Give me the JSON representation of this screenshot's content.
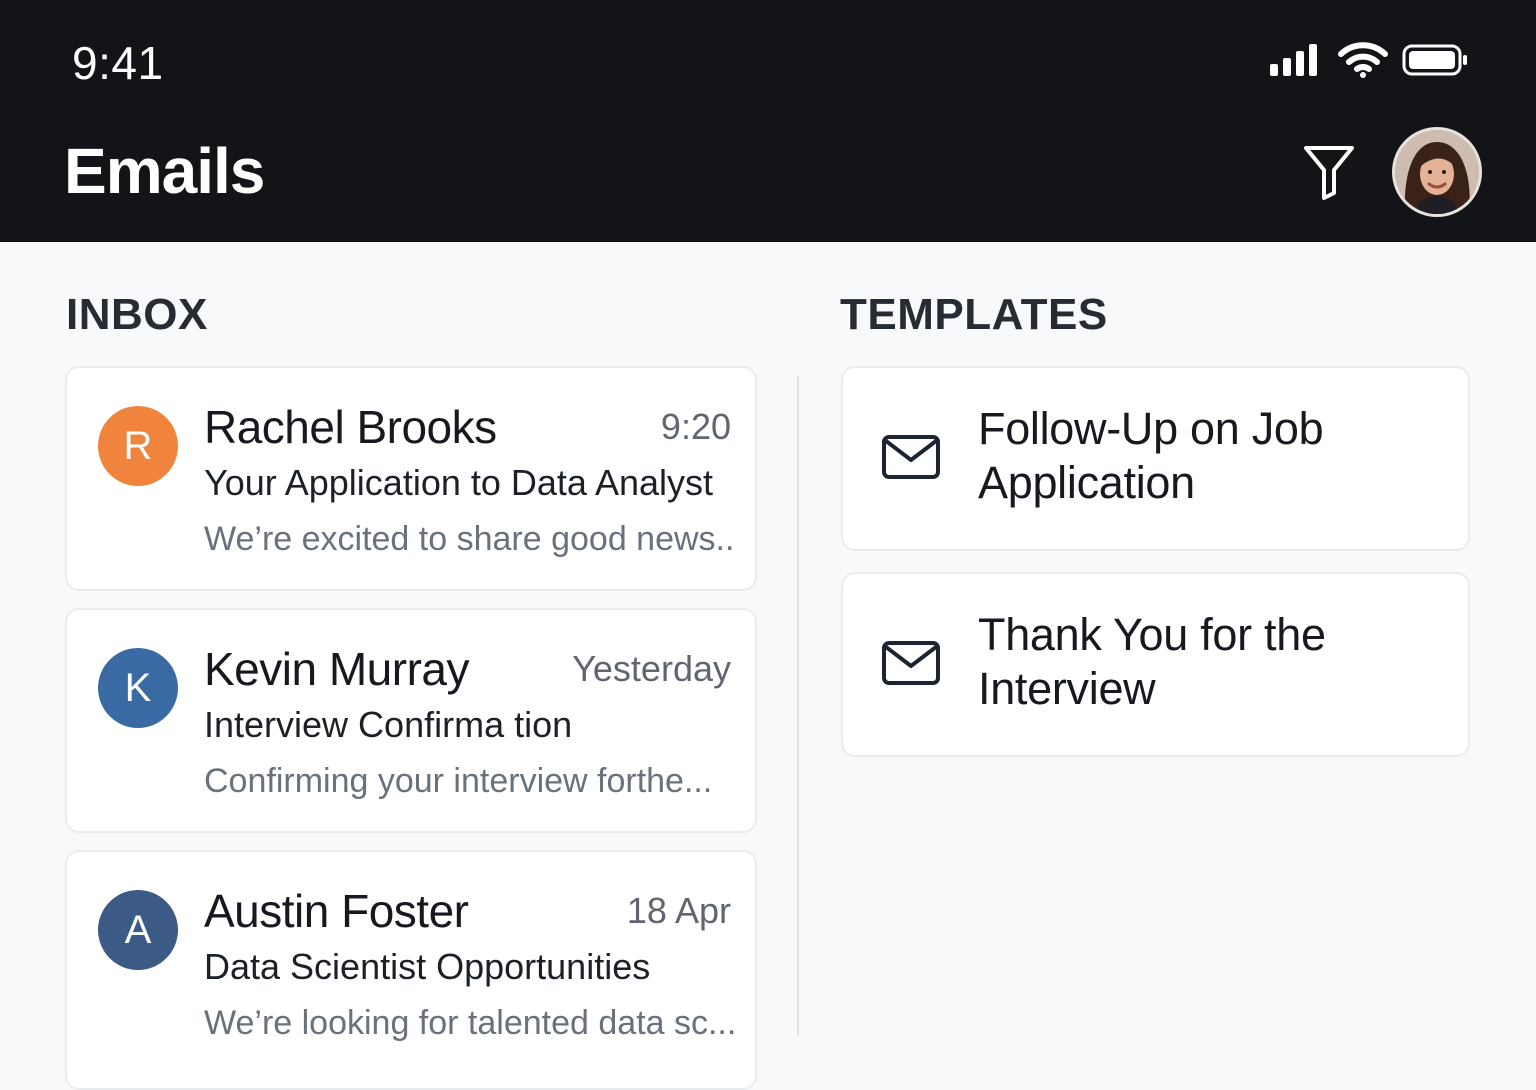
{
  "status_bar": {
    "time": "9:41",
    "icons": [
      "signal-icon",
      "wifi-icon",
      "battery-icon"
    ]
  },
  "header": {
    "title": "Emails",
    "filter_icon": "filter-icon",
    "avatar": "profile-avatar"
  },
  "inbox": {
    "heading": "INBOX",
    "emails": [
      {
        "initial": "R",
        "avatar_color": "#f0843c",
        "sender": "Rachel Brooks",
        "time": "9:20",
        "subject": "Your Application to Data Analyst",
        "preview": "We’re excited to share good news..."
      },
      {
        "initial": "K",
        "avatar_color": "#3a6aa4",
        "sender": "Kevin Murray",
        "time": "Yesterday",
        "subject": "Interview Confirma tion",
        "preview": "Confirming your interview forthe..."
      },
      {
        "initial": "A",
        "avatar_color": "#3b5a85",
        "sender": "Austin Foster",
        "time": "18 Apr",
        "subject": "Data Scientist Opportunities",
        "preview": "We’re looking for talented data sc..."
      }
    ]
  },
  "templates": {
    "heading": "TEMPLATES",
    "icon": "mail-icon",
    "items": [
      {
        "title": "Follow-Up on Job Application"
      },
      {
        "title": "Thank You for the Interview"
      }
    ]
  },
  "colors": {
    "header_bg": "#121418",
    "page_bg": "#f8f9fa",
    "card_border": "#e9ecef"
  }
}
